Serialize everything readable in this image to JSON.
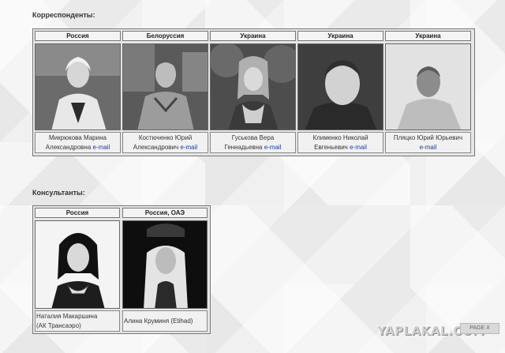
{
  "correspondents": {
    "title": "Корреспонденты:",
    "people": [
      {
        "country": "Россия",
        "name_line1": "Микрюкова Марина",
        "name_line2": "Александровна",
        "email_label": "e-mail",
        "photo_icon": "woman-portrait"
      },
      {
        "country": "Белоруссия",
        "name_line1": "Костюченко Юрий",
        "name_line2": "Александрович",
        "email_label": "e-mail",
        "photo_icon": "man-portrait"
      },
      {
        "country": "Украина",
        "name_line1": "Гуськова Вера",
        "name_line2": "Геннадьевна",
        "email_label": "e-mail",
        "photo_icon": "woman-portrait"
      },
      {
        "country": "Украина",
        "name_line1": "Клименко Николай",
        "name_line2": "Евгеньевич",
        "email_label": "e-mail",
        "photo_icon": "man-portrait"
      },
      {
        "country": "Украина",
        "name_line1": "Пляцко Юрий Юрьевич",
        "name_line2": "",
        "email_label": "e-mail",
        "photo_icon": "man-portrait"
      }
    ]
  },
  "consultants": {
    "title": "Консультанты:",
    "people": [
      {
        "country": "Россия",
        "name_line1": "Наталия Макаршина",
        "name_line2": "(АК Трансаэро)",
        "photo_icon": "flight-attendant-portrait"
      },
      {
        "country": "Россия, ОАЭ",
        "name_line1": "Алина Круминя (Etihad)",
        "name_line2": "",
        "photo_icon": "flight-attendant-portrait"
      }
    ]
  },
  "watermark": "YAPLAKAL.COM",
  "pager_label": "PAGE X"
}
